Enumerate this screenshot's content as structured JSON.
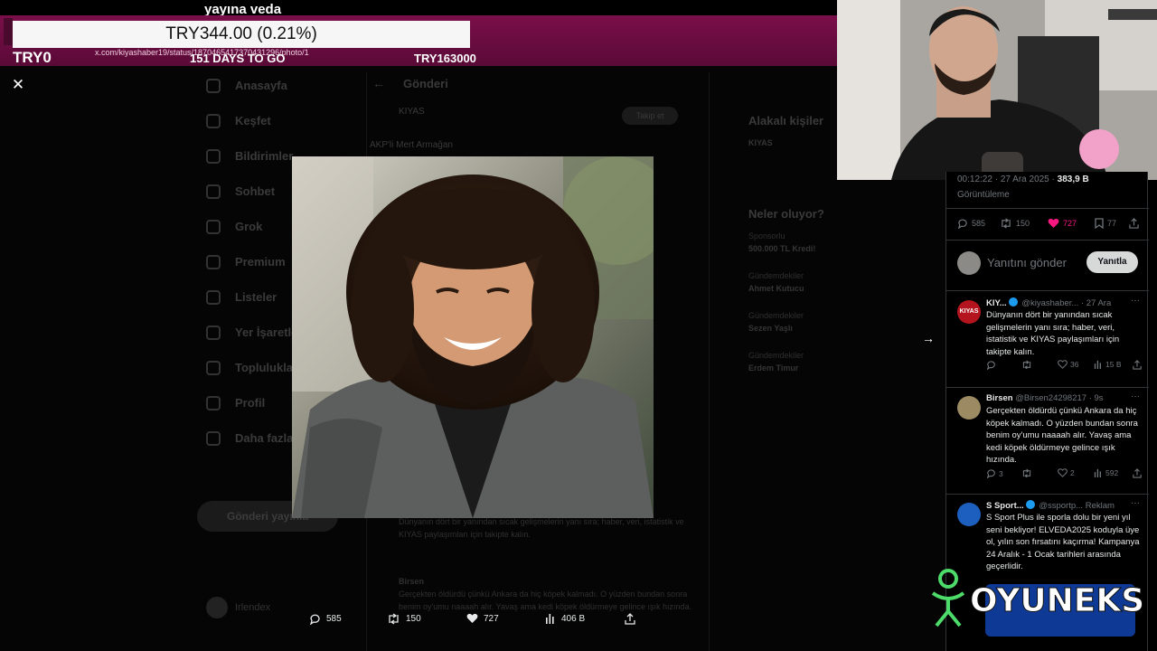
{
  "ticker": {
    "headline": "yayına veda",
    "amount": "TRY344.00 (0.21%)",
    "left_value": "TRY0",
    "url": "x.com/kiyashaber19/status/1870465417370431296/photo/1",
    "days": "151 DAYS TO GO",
    "goal": "TRY163000"
  },
  "background": {
    "nav": [
      "Anasayfa",
      "Keşfet",
      "Bildirimler",
      "Sohbet",
      "Grok",
      "Premium",
      "Listeler",
      "Yer İşaretleri",
      "Topluluklar",
      "Profil",
      "Daha fazla"
    ],
    "post_button": "Gönderi yayınla",
    "profile_name": "Irlendex",
    "center_title": "Gönderi",
    "author": "KIYAS",
    "subtitle": "AKP'li Mert Armağan",
    "follow": "Takip et",
    "reply_text": "Dünyanın dört bir yanından sıcak gelişmelerin yanı sıra; haber, veri, istatistik ve KIYAS paylaşımları için takipte kalın.",
    "reply2_author": "Birsen",
    "reply2_text": "Gerçekten öldürdü çünkü Ankara da hiç köpek kalmadı. O yüzden bundan sonra benim oy'umu naaaah alır. Yavaş ama kedi köpek öldürmeye gelince ışık hızında.",
    "right_heading1": "Alakalı kişiler",
    "right_person": "KIYAS",
    "right_heading2": "Neler oluyor?",
    "trends": [
      {
        "meta": "Sponsorlu",
        "title": "500.000 TL Kredi!"
      },
      {
        "meta": "Gündemdekiler",
        "title": "Ahmet Kutucu"
      },
      {
        "meta": "Gündemdekiler",
        "title": "Sezen Yaşlı"
      },
      {
        "meta": "Gündemdekiler",
        "title": "Erdem Timur"
      }
    ]
  },
  "actions": {
    "replies": "585",
    "reposts": "150",
    "likes": "727",
    "views": "406 B"
  },
  "panel": {
    "timestamp": "00:12:22 · 27 Ara 2025 · ",
    "views_count": "383,9 B",
    "views_label": "Görüntüleme",
    "metrics": {
      "replies": "585",
      "reposts": "150",
      "likes": "727",
      "bookmarks": "77"
    },
    "reply_placeholder": "Yanıtını gönder",
    "reply_button": "Yanıtla",
    "tweets": [
      {
        "name": "KIY...",
        "handle": "@kiyashaber...",
        "time": "· 27 Ara",
        "avatar_label": "KIYAS",
        "text": "Dünyanın dört bir yanından sıcak gelişmelerin yanı sıra; haber, veri, istatistik ve KIYAS paylaşımları için takipte kalın.",
        "likes": "36",
        "views": "15 B"
      },
      {
        "name": "Birsen",
        "handle": "@Birsen24298217",
        "time": "· 9s",
        "text": "Gerçekten öldürdü çünkü Ankara da hiç köpek kalmadı. O yüzden bundan sonra benim oy'umu naaaah alır. Yavaş ama kedi köpek öldürmeye gelince ışık hızında.",
        "replies": "3",
        "likes": "2",
        "views": "592"
      },
      {
        "name": "S Sport...",
        "handle": "@ssportp...",
        "time": "Reklam",
        "text": "S Sport Plus ile sporla dolu bir yeni yıl seni bekliyor! ELVEDA2025 koduyla üye ol, yılın son fırsatını kaçırma! Kampanya 24 Aralık - 1 Ocak tarihleri arasında geçerlidir."
      }
    ]
  },
  "overlay_logo": "OYUNEKS",
  "colors": {
    "ticker_band": "#6e0d44",
    "like_pink": "#f91880",
    "accent_blue": "#1d9bf0",
    "logo_green": "#4ddc6a"
  }
}
